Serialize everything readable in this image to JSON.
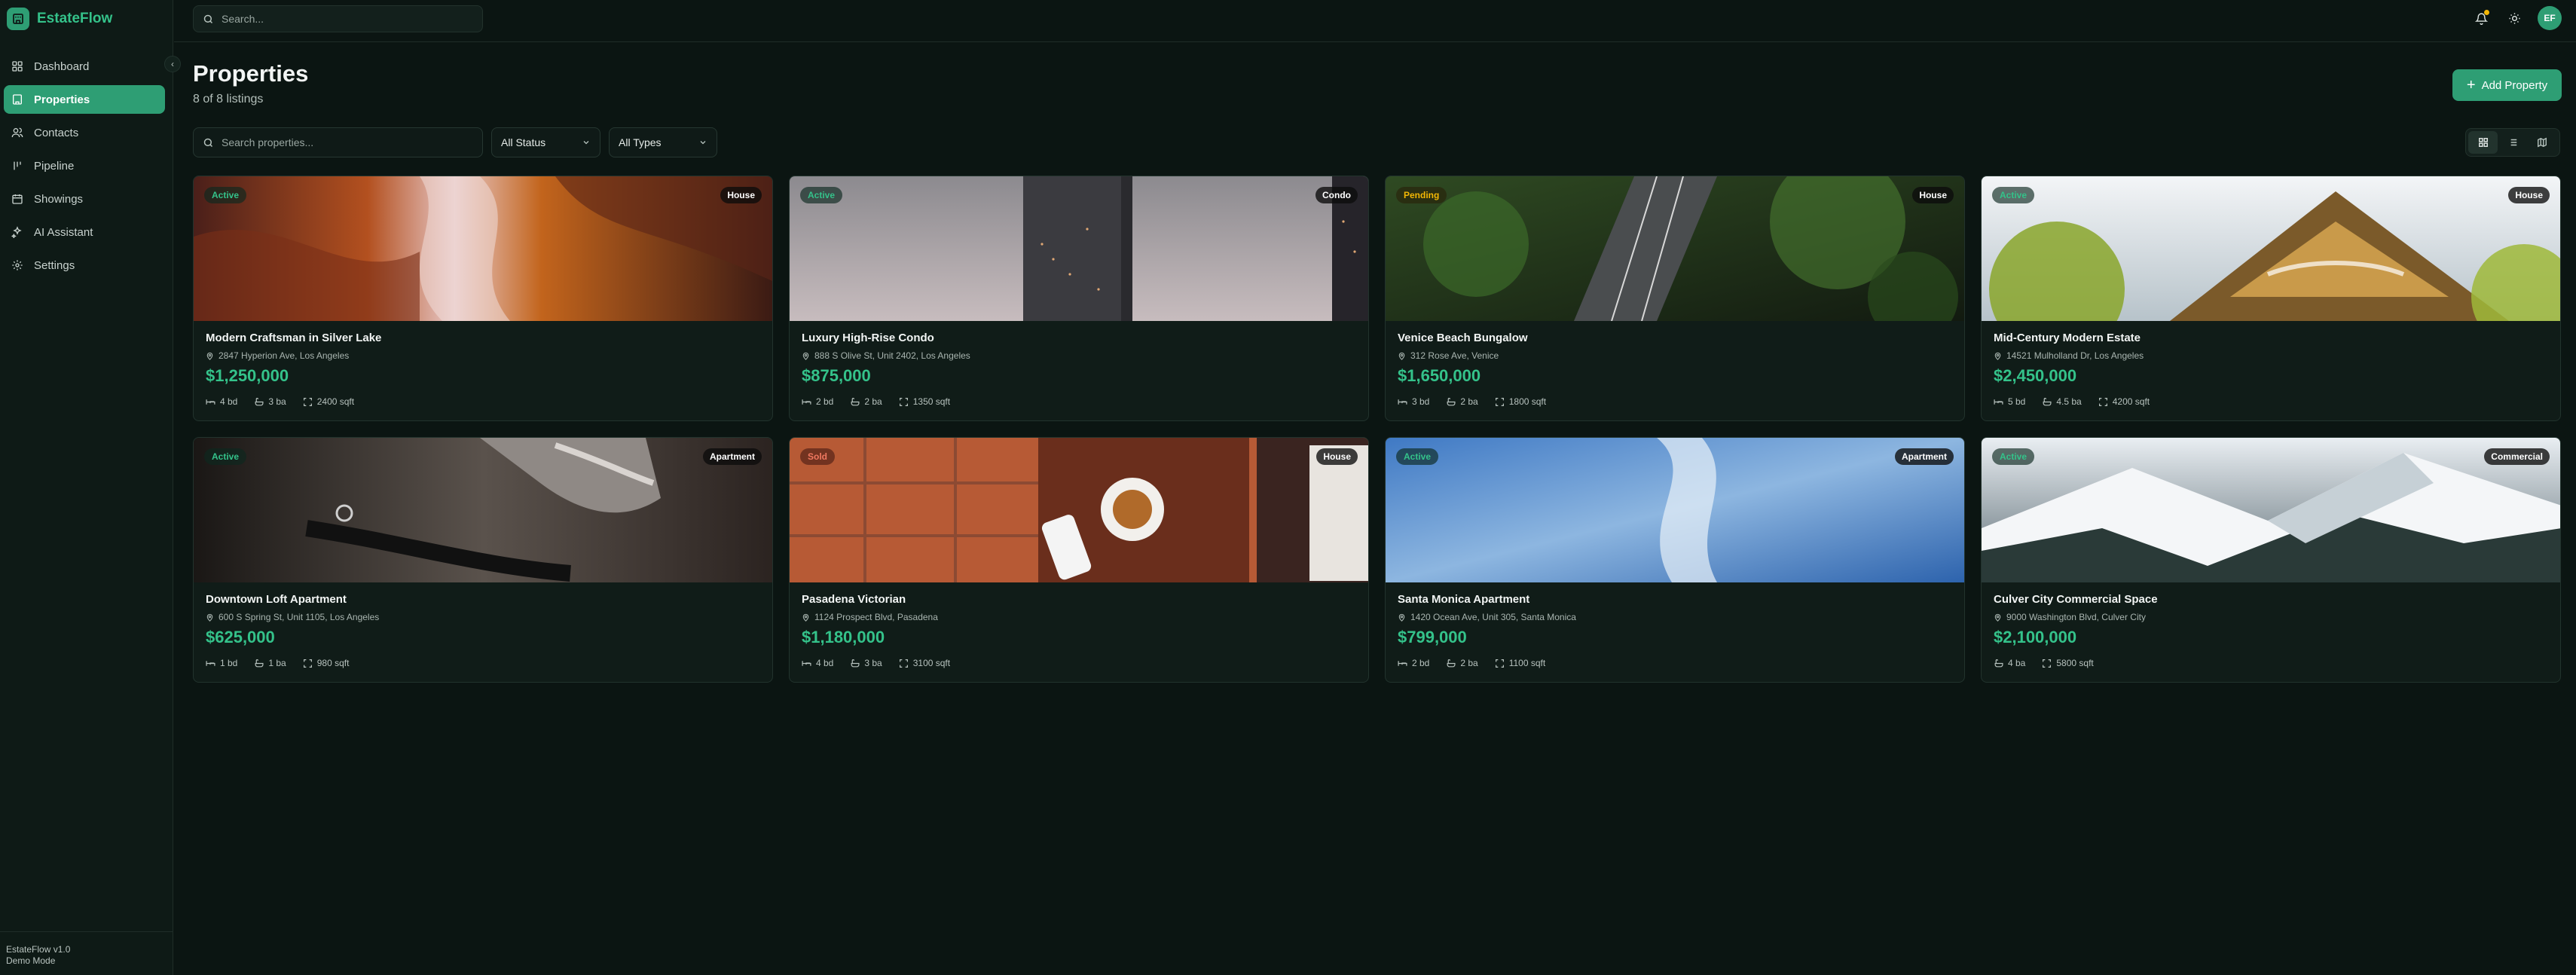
{
  "app": {
    "name": "EstateFlow",
    "version": "EstateFlow v1.0",
    "mode": "Demo Mode"
  },
  "colors": {
    "accent": "#2e9e74",
    "accent_text": "#34c28a",
    "pending": "#f2b705",
    "sold": "#f07860",
    "background": "#0b1512"
  },
  "sidebar": {
    "items": [
      {
        "label": "Dashboard",
        "icon": "dashboard-icon"
      },
      {
        "label": "Properties",
        "icon": "building-icon",
        "active": true
      },
      {
        "label": "Contacts",
        "icon": "contacts-icon"
      },
      {
        "label": "Pipeline",
        "icon": "pipeline-icon"
      },
      {
        "label": "Showings",
        "icon": "calendar-icon"
      },
      {
        "label": "AI Assistant",
        "icon": "sparkles-icon"
      },
      {
        "label": "Settings",
        "icon": "gear-icon"
      }
    ]
  },
  "topbar": {
    "search_placeholder": "Search...",
    "avatar_initials": "EF"
  },
  "page": {
    "title": "Properties",
    "subtitle": "8 of 8 listings",
    "add_button": "Add Property",
    "search_placeholder": "Search properties...",
    "status_filter": "All Status",
    "type_filter": "All Types",
    "view_modes": [
      "grid",
      "list",
      "map"
    ],
    "active_view": "grid"
  },
  "properties": [
    {
      "title": "Modern Craftsman in Silver Lake",
      "address": "2847 Hyperion Ave, Los Angeles",
      "price": "$1,250,000",
      "status": "Active",
      "type": "House",
      "beds": "4 bd",
      "baths": "3 ba",
      "sqft": "2400 sqft"
    },
    {
      "title": "Luxury High-Rise Condo",
      "address": "888 S Olive St, Unit 2402, Los Angeles",
      "price": "$875,000",
      "status": "Active",
      "type": "Condo",
      "beds": "2 bd",
      "baths": "2 ba",
      "sqft": "1350 sqft"
    },
    {
      "title": "Venice Beach Bungalow",
      "address": "312 Rose Ave, Venice",
      "price": "$1,650,000",
      "status": "Pending",
      "type": "House",
      "beds": "3 bd",
      "baths": "2 ba",
      "sqft": "1800 sqft"
    },
    {
      "title": "Mid-Century Modern Estate",
      "address": "14521 Mulholland Dr, Los Angeles",
      "price": "$2,450,000",
      "status": "Active",
      "type": "House",
      "beds": "5 bd",
      "baths": "4.5 ba",
      "sqft": "4200 sqft"
    },
    {
      "title": "Downtown Loft Apartment",
      "address": "600 S Spring St, Unit 1105, Los Angeles",
      "price": "$625,000",
      "status": "Active",
      "type": "Apartment",
      "beds": "1 bd",
      "baths": "1 ba",
      "sqft": "980 sqft"
    },
    {
      "title": "Pasadena Victorian",
      "address": "1124 Prospect Blvd, Pasadena",
      "price": "$1,180,000",
      "status": "Sold",
      "type": "House",
      "beds": "4 bd",
      "baths": "3 ba",
      "sqft": "3100 sqft"
    },
    {
      "title": "Santa Monica Apartment",
      "address": "1420 Ocean Ave, Unit 305, Santa Monica",
      "price": "$799,000",
      "status": "Active",
      "type": "Apartment",
      "beds": "2 bd",
      "baths": "2 ba",
      "sqft": "1100 sqft"
    },
    {
      "title": "Culver City Commercial Space",
      "address": "9000 Washington Blvd, Culver City",
      "price": "$2,100,000",
      "status": "Active",
      "type": "Commercial",
      "beds": "",
      "baths": "4 ba",
      "sqft": "5800 sqft"
    }
  ]
}
